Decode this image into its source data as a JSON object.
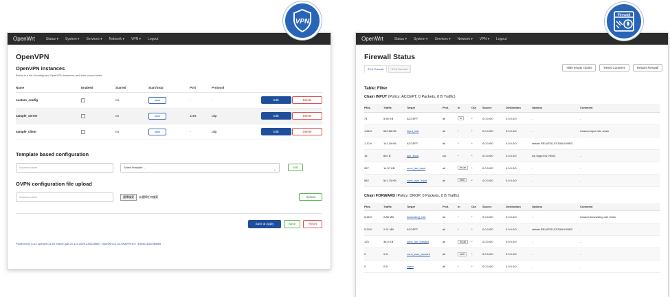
{
  "openvpn_window": {
    "nav": {
      "brand": "OpenWrt",
      "items": [
        "Status ▾",
        "System ▾",
        "Services ▾",
        "Network ▾",
        "VPN ▾",
        "Logout"
      ]
    },
    "title": "OpenVPN",
    "instances_heading": "OpenVPN instances",
    "instances_desc": "Below is a list of configured OpenVPN instances and their current state",
    "table_headers": [
      "Name",
      "Enabled",
      "Started",
      "Start/Stop",
      "Port",
      "Protocol"
    ],
    "rows": [
      {
        "name": "custom_config",
        "started": "no",
        "start_label": "start",
        "port": "-",
        "protocol": "-",
        "edit": "Edit",
        "delete": "Delete"
      },
      {
        "name": "sample_server",
        "started": "no",
        "start_label": "start",
        "port": "1194",
        "protocol": "udp",
        "edit": "Edit",
        "delete": "Delete"
      },
      {
        "name": "sample_client",
        "started": "no",
        "start_label": "start",
        "port": "-",
        "protocol": "udp",
        "edit": "Edit",
        "delete": "Delete"
      }
    ],
    "template_heading": "Template based configuration",
    "template_name_placeholder": "Instance name",
    "template_select": "Select template ...",
    "add_label": "Add",
    "upload_heading": "OVPN configuration file upload",
    "upload_name_placeholder": "Instance name",
    "file_button": "選擇檔案",
    "file_status": "未選擇任何檔案",
    "upload_label": "Upload",
    "save_apply_label": "Save & Apply",
    "save_label": "Save",
    "reset_label": "Reset",
    "footer": "Powered by LuCI openwrt-21.02 branch (git-21.124.26291-8422886) / OpenWrt 21.02-SNAPSHOT r15956-4387fdb8b5"
  },
  "firewall_window": {
    "nav": {
      "brand": "OpenWrt",
      "items": [
        "Status ▾",
        "System ▾",
        "Services ▾",
        "Network ▾",
        "VPN ▾",
        "Logout"
      ]
    },
    "title": "Firewall Status",
    "tabs": [
      "IPv4 Firewall",
      "IPv6 Firewall"
    ],
    "buttons": [
      "Hide empty chains",
      "Reset Counters",
      "Restart Firewall"
    ],
    "table_title": "Table: Filter",
    "input_chain": {
      "name": "Chain INPUT",
      "policy": "(Policy: ACCEPT, 0 Packets, 0 B Traffic)"
    },
    "forward_chain": {
      "name": "Chain FORWARD",
      "policy": "(Policy: DROP, 0 Packets, 0 B Traffic)"
    },
    "headers": [
      "Pkts.",
      "Traffic",
      "Target",
      "Prot.",
      "In",
      "Out",
      "Source",
      "Destination",
      "Options",
      "Comment"
    ],
    "input_rows": [
      [
        "74",
        "5.60 KB",
        "ACCEPT",
        "all",
        "lo",
        "*",
        "0.0.0.0/0",
        "0.0.0.0/0",
        "-",
        "-"
      ],
      [
        "1.86 K",
        "687.58 KB",
        "input_rule",
        "all",
        "*",
        "*",
        "0.0.0.0/0",
        "0.0.0.0/0",
        "-",
        "Custom input rule chain"
      ],
      [
        "1.12 K",
        "141.29 KB",
        "ACCEPT",
        "all",
        "*",
        "*",
        "0.0.0.0/0",
        "0.0.0.0/0",
        "ctstate RELATED,ESTABLISHED",
        "-"
      ],
      [
        "16",
        "840 B",
        "syn_flood",
        "tcp",
        "*",
        "*",
        "0.0.0.0/0",
        "0.0.0.0/0",
        "tcp flags:0x17/0x02",
        "-"
      ],
      [
        "287",
        "14.37 KB",
        "zone_lan_input",
        "all",
        "br-lan",
        "*",
        "0.0.0.0/0",
        "0.0.0.0/0",
        "-",
        "-"
      ],
      [
        "582",
        "541.75 KB",
        "zone_wan_input",
        "all",
        "eth0",
        "*",
        "0.0.0.0/0",
        "0.0.0.0/0",
        "-",
        "-"
      ]
    ],
    "forward_rows": [
      [
        "5.36 K",
        "2.88 MB",
        "forwarding_rule",
        "all",
        "*",
        "*",
        "0.0.0.0/0",
        "0.0.0.0/0",
        "-",
        "Custom forwarding rule chain"
      ],
      [
        "5.23 K",
        "2.91 MB",
        "ACCEPT",
        "all",
        "*",
        "*",
        "0.0.0.0/0",
        "0.0.0.0/0",
        "ctstate RELATED,ESTABLISHED",
        "-"
      ],
      [
        "125",
        "36.0 KB",
        "zone_lan_forward",
        "all",
        "br-lan",
        "*",
        "0.0.0.0/0",
        "0.0.0.0/0",
        "-",
        "-"
      ],
      [
        "0",
        "0 B",
        "zone_wan_forward",
        "all",
        "eth0",
        "*",
        "0.0.0.0/0",
        "0.0.0.0/0",
        "-",
        "-"
      ],
      [
        "0",
        "0 B",
        "reject",
        "all",
        "*",
        "*",
        "0.0.0.0/0",
        "0.0.0.0/0",
        "-",
        "-"
      ]
    ]
  },
  "badges": {
    "vpn_label": "VPN",
    "firewall_label": "Firewall",
    "color": "#2864b8"
  }
}
